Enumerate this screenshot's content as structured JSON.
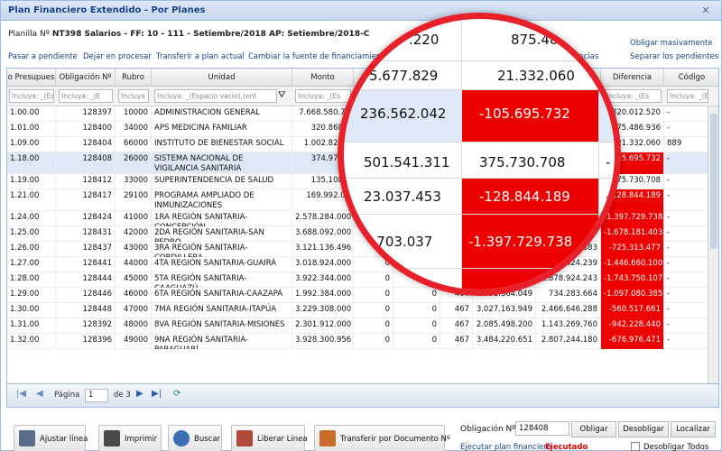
{
  "window": {
    "title": "Plan Financiero Extendido - Por Planes",
    "close_icon": "close-icon"
  },
  "planilla": {
    "label": "Planilla Nº",
    "value": "NT398 Salarios - FF: 10 - 111 - Setiembre/2018 AP: Setiembre/2018-C"
  },
  "actions": [
    "Pasar a pendiente",
    "Dejar en procesar",
    "Transferir a plan actual",
    "Cambiar la fuente de financiamiento",
    "ancias"
  ],
  "right_links": {
    "obligar": "Obligar masivamente",
    "separar": "Separar los pendientes"
  },
  "columns": [
    {
      "label": "o Presupues",
      "filter": "Incluya: _(Esp"
    },
    {
      "label": "Obligación Nº",
      "filter": "Incluya: _(E"
    },
    {
      "label": "Rubro",
      "filter": "Incluya"
    },
    {
      "label": "Unidad",
      "filter": "Incluya: _(Espacio vacío),(ent"
    },
    {
      "label": "Monto",
      "filter": "Incluya: _(Es"
    },
    {
      "label": "",
      "filter": ""
    },
    {
      "label": "",
      "filter": ""
    },
    {
      "label": "",
      "filter": ""
    },
    {
      "label": "",
      "filter": ""
    },
    {
      "label": "",
      "filter": ""
    },
    {
      "label": "Diferencia",
      "filter": "Incluya: _(Es"
    },
    {
      "label": "Código",
      "filter": "Incluya: _(E"
    }
  ],
  "rows": [
    {
      "pres": "1.00.00",
      "obl": "128397",
      "rubro": "10000",
      "unidad": "ADMINISTRACION GENERAL",
      "monto": "7.668.580.76",
      "c6": "",
      "c7": "",
      "c8": "",
      "c9": "",
      "c10": "",
      "dif": "820.012.520",
      "cod": "-",
      "neg": false
    },
    {
      "pres": "1.01.00",
      "obl": "128400",
      "rubro": "34000",
      "unidad": "APS MEDICINA FAMILIAR",
      "monto": "320.868.0",
      "c6": "",
      "c7": "",
      "c8": "",
      "c9": "",
      "c10": "",
      "dif": "75.486.936",
      "cod": "-",
      "neg": false
    },
    {
      "pres": "1.09.00",
      "obl": "128404",
      "rubro": "66000",
      "unidad": "INSTITUTO DE BIENESTAR SOCIAL",
      "monto": "1.002.824.4",
      "c6": "",
      "c7": "",
      "c8": "",
      "c9": "",
      "c10": "",
      "dif": "21.332.060",
      "cod": "889",
      "neg": false
    },
    {
      "pres": "1.18.00",
      "obl": "128408",
      "rubro": "26000",
      "unidad": "SISTEMA NACIONAL DE VIGILANCIA SANITARIA",
      "monto": "374.976.0",
      "c6": "",
      "c7": "",
      "c8": "",
      "c9": "",
      "c10": "",
      "dif": "-105.695.732",
      "cod": "-",
      "neg": true
    },
    {
      "pres": "1.19.00",
      "obl": "128412",
      "rubro": "33000",
      "unidad": "SUPERINTENDENCIA DE SALUD",
      "monto": "135.108.0",
      "c6": "",
      "c7": "",
      "c8": "",
      "c9": "",
      "c10": "",
      "dif": "375.730.708",
      "cod": "-",
      "neg": false
    },
    {
      "pres": "1.21.00",
      "obl": "128417",
      "rubro": "29100",
      "unidad": "PROGRAMA AMPLIADO DE INMUNIZACIONES",
      "monto": "169.992.00",
      "c6": "",
      "c7": "",
      "c8": "",
      "c9": "",
      "c10": "",
      "dif": "-128.844.189",
      "cod": "-",
      "neg": true
    },
    {
      "pres": "1.24.00",
      "obl": "128424",
      "rubro": "41000",
      "unidad": "1RA REGIÓN SANITARIA-CONCEPCIÓN",
      "monto": "2.578.284.000",
      "c6": "",
      "c7": "",
      "c8": "",
      "c9": "",
      "c10": "",
      "dif": "-1.397.729.738",
      "cod": "-",
      "neg": true
    },
    {
      "pres": "1.25.00",
      "obl": "128431",
      "rubro": "42000",
      "unidad": "2DA REGIÓN SANITARIA-SAN PEDRO",
      "monto": "3.688.092.000",
      "c6": "",
      "c7": "",
      "c8": "",
      "c9": "",
      "c10": "603",
      "dif": "-1.678.181.403",
      "cod": "-",
      "neg": true
    },
    {
      "pres": "1.26.00",
      "obl": "128437",
      "rubro": "43000",
      "unidad": "3RA REGIÓN SANITARIA-CORDILLERA",
      "monto": "3.121.136.496",
      "c6": "",
      "c7": "",
      "c8": "",
      "c9": "",
      "c10": "07.383",
      "dif": "-725.313.477",
      "cod": "-",
      "neg": true
    },
    {
      "pres": "1.27.00",
      "obl": "128441",
      "rubro": "44000",
      "unidad": "4TA REGIÓN SANITARIA-GUAIRÁ",
      "monto": "3.018.924.000",
      "c6": "0",
      "c7": "0",
      "c8": "",
      "c9": "",
      "c10": "1.331.424.239",
      "dif": "-1.446.660.100",
      "cod": "-",
      "neg": true
    },
    {
      "pres": "1.28.00",
      "obl": "128444",
      "rubro": "45000",
      "unidad": "5TA REGIÓN SANITARIA-CAAGUAZÚ",
      "monto": "3.922.344.000",
      "c6": "0",
      "c7": "0",
      "c8": "467",
      "c9": "3.622.674.350",
      "c10": "1.878.924.243",
      "dif": "-1.743.750.107",
      "cod": "-",
      "neg": true
    },
    {
      "pres": "1.29.00",
      "obl": "128446",
      "rubro": "46000",
      "unidad": "6TA REGIÓN SANITARIA-CAAZAPÁ",
      "monto": "1.992.384.000",
      "c6": "0",
      "c7": "0",
      "c8": "467",
      "c9": "1.831.364.049",
      "c10": "734.283.664",
      "dif": "-1.097.080.385",
      "cod": "-",
      "neg": true
    },
    {
      "pres": "1.30.00",
      "obl": "128448",
      "rubro": "47000",
      "unidad": "7MA REGIÓN SANITARIA-ITAPÚA",
      "monto": "3.229.308.000",
      "c6": "0",
      "c7": "0",
      "c8": "467",
      "c9": "3.027.163.949",
      "c10": "2.466.646.288",
      "dif": "-560.517.661",
      "cod": "-",
      "neg": true
    },
    {
      "pres": "1.31.00",
      "obl": "128392",
      "rubro": "48000",
      "unidad": "8VA REGIÓN SANITARIA-MISIONES",
      "monto": "2.301.912.000",
      "c6": "0",
      "c7": "0",
      "c8": "467",
      "c9": "2.085.498.200",
      "c10": "1.143.269.760",
      "dif": "-942.228.440",
      "cod": "-",
      "neg": true
    },
    {
      "pres": "1.32.00",
      "obl": "128396",
      "rubro": "49000",
      "unidad": "9NA REGIÓN SANITARIA-PARAGUARÍ",
      "monto": "3.928.300.956",
      "c6": "0",
      "c7": "0",
      "c8": "467",
      "c9": "3.484.220.651",
      "c10": "2.807.244.180",
      "dif": "-676.976.471",
      "cod": "-",
      "neg": true
    }
  ],
  "pager": {
    "page_label": "Página",
    "page_value": "1",
    "of_label": "de 3"
  },
  "toolbar": {
    "ajustar": "Ajustar línea",
    "imprimir": "Imprimir",
    "buscar": "Buscar",
    "liberar": "Liberar Linea",
    "transferir": "Transferir por Documento Nº"
  },
  "obligacion": {
    "label": "Obligación Nº",
    "value": "128408",
    "obligar": "Obligar",
    "desobligar": "Desobligar",
    "localizar": "Localizar"
  },
  "footer": {
    "ejecutar": "Ejecutar plan financiero",
    "estado": "Ejecutado",
    "desobligar_todos": "Desobligar Todos"
  },
  "magnifier": {
    "r1c1": ".220",
    "r1c2": "875.486",
    "r2c1": "5.677.829",
    "r2c2": "21.332.060",
    "r3c1": "236.562.042",
    "r3c2": "-105.695.732",
    "r4c1": "501.541.311",
    "r4c2": "375.730.708",
    "r4c3": "-",
    "r5c1": "23.037.453",
    "r5c2": "-128.844.189",
    "r5c3": "-",
    "r6c1": "7.703.037",
    "r6c2": "-1.397.729.738",
    "r6c3": "-"
  },
  "colors": {
    "negative": "#ee0000",
    "selected_row": "#dfe8f6",
    "link": "#15428b",
    "border": "#99bbe8"
  }
}
